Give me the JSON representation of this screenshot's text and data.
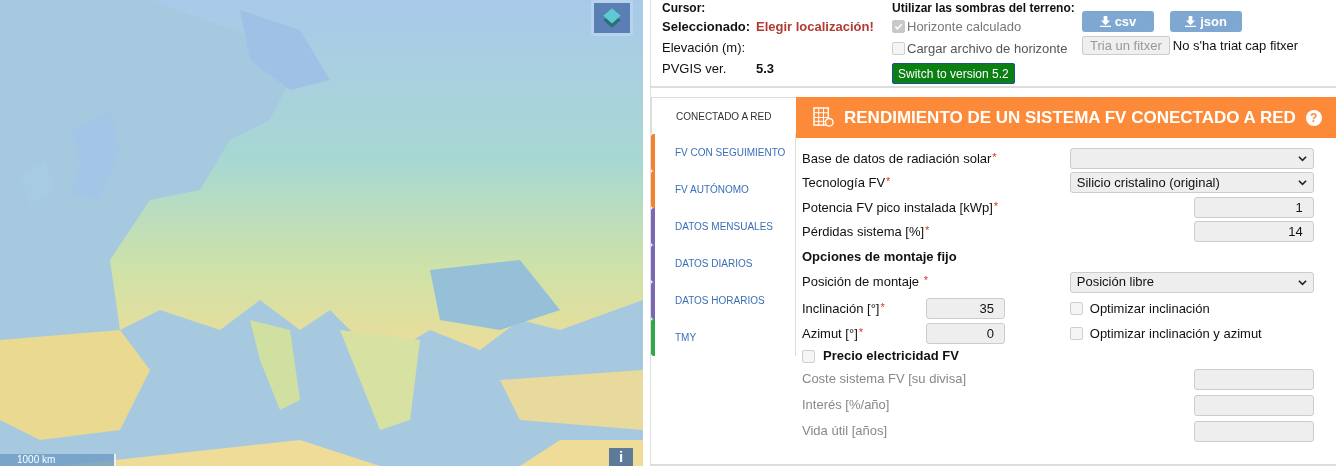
{
  "map": {
    "scale": "1000 km",
    "info_button": "i"
  },
  "location": {
    "cursor_label": "Cursor:",
    "selected_label": "Seleccionado:",
    "selected_value": "Elegir localización!",
    "elevation_label": "Elevación (m):",
    "version_label": "PVGIS ver.",
    "version_value": "5.3"
  },
  "horizon": {
    "title": "Utilizar las sombras del terreno:",
    "options": [
      {
        "label": "Horizonte calculado",
        "checked": true,
        "disabled": true
      },
      {
        "label": "Cargar archivo de horizonte",
        "checked": false,
        "disabled": false
      }
    ],
    "switch_button": "Switch to version 5.2"
  },
  "downloads": [
    "csv",
    "json"
  ],
  "file": {
    "button": "Tria un fitxer",
    "status": "No s'ha triat cap fitxer"
  },
  "tabs": [
    {
      "label": "CONECTADO A RED",
      "selected": true
    },
    {
      "label": "FV CON SEGUIMIENTO",
      "selected": false,
      "color": "#f5822a"
    },
    {
      "label": "FV AUTÓNOMO",
      "selected": false,
      "color": "#f5822a"
    },
    {
      "label": "DATOS MENSUALES",
      "selected": false,
      "color": "#7b68b5"
    },
    {
      "label": "DATOS DIARIOS",
      "selected": false,
      "color": "#7b68b5"
    },
    {
      "label": "DATOS HORARIOS",
      "selected": false,
      "color": "#7b68b5"
    },
    {
      "label": "TMY",
      "selected": false,
      "color": "#2ea84a"
    }
  ],
  "panel": {
    "title": "RENDIMIENTO DE UN SISTEMA FV CONECTADO A RED",
    "help": "?",
    "fields": [
      {
        "kind": "select",
        "label": "Base de datos de radiación solar",
        "required_mark": "*"
      },
      {
        "kind": "select",
        "label": "Tecnología FV",
        "required_mark": "*",
        "value": "Silicio cristalino (original)"
      },
      {
        "kind": "number",
        "label": "Potencia FV pico instalada [kWp]",
        "required_mark": "*",
        "value": "1"
      },
      {
        "kind": "number",
        "label": "Pérdidas sistema [%]",
        "required_mark": "*",
        "value": "14"
      }
    ],
    "mounting": {
      "heading": "Opciones de montaje fijo",
      "position": {
        "label": "Posición de montaje",
        "required_mark": "*",
        "value": "Posición libre"
      },
      "angles": [
        {
          "label": "Inclinación [°]",
          "required_mark": "*",
          "value": "35",
          "option": {
            "label": "Optimizar inclinación",
            "checked": false
          }
        },
        {
          "label": "Azimut [°]",
          "required_mark": "*",
          "value": "0",
          "option": {
            "label": "Optimizar inclinación y azimut",
            "checked": false
          }
        }
      ]
    },
    "price": {
      "label": "Precio electricidad FV",
      "checked": false,
      "fields": [
        {
          "label": "Coste sistema FV [su divisa]",
          "disabled": true
        },
        {
          "label": "Interés [%/año]",
          "disabled": true
        },
        {
          "label": "Vida útil [años]",
          "disabled": true
        }
      ]
    }
  }
}
